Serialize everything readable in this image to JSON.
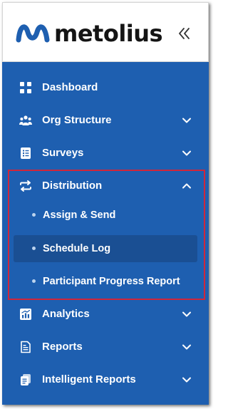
{
  "brand": {
    "name": "metolius",
    "logo_icon": "wave-logo-icon",
    "logo_color": "#1e5fb0"
  },
  "collapse_button": {
    "glyph": "«",
    "icon": "double-chevron-left-icon"
  },
  "colors": {
    "sidebar_bg": "#1e5fb0",
    "active_item_bg": "#1a4f93",
    "highlight_border": "#d0263b",
    "text": "#ffffff"
  },
  "sidebar": {
    "items": [
      {
        "label": "Dashboard",
        "icon": "grid-icon",
        "has_chevron": false
      },
      {
        "label": "Org Structure",
        "icon": "people-icon",
        "has_chevron": true,
        "expanded": false
      },
      {
        "label": "Surveys",
        "icon": "survey-list-icon",
        "has_chevron": true,
        "expanded": false
      },
      {
        "label": "Distribution",
        "icon": "swap-arrows-icon",
        "has_chevron": true,
        "expanded": true,
        "children": [
          {
            "label": "Assign & Send",
            "active": false
          },
          {
            "label": "Schedule Log",
            "active": true
          },
          {
            "label": "Participant Progress Report",
            "active": false
          }
        ]
      },
      {
        "label": "Analytics",
        "icon": "analytics-chart-icon",
        "has_chevron": true,
        "expanded": false
      },
      {
        "label": "Reports",
        "icon": "report-document-icon",
        "has_chevron": true,
        "expanded": false
      },
      {
        "label": "Intelligent Reports",
        "icon": "stacked-reports-icon",
        "has_chevron": true,
        "expanded": false
      }
    ]
  }
}
